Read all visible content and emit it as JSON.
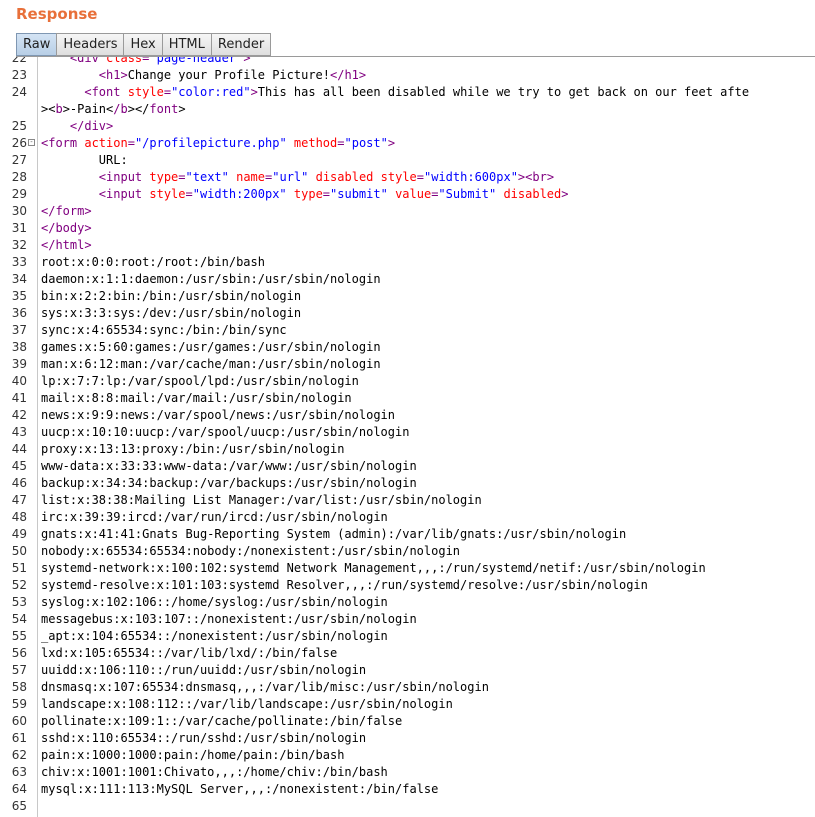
{
  "panel": {
    "title": "Response"
  },
  "tabs": [
    {
      "label": "Raw",
      "active": true
    },
    {
      "label": "Headers",
      "active": false
    },
    {
      "label": "Hex",
      "active": false
    },
    {
      "label": "HTML",
      "active": false
    },
    {
      "label": "Render",
      "active": false
    }
  ],
  "colors": {
    "title": "#e8703a",
    "tag": "#800080",
    "attribute": "#ff0000",
    "value": "#0000ff",
    "text": "#000000"
  },
  "lines": [
    {
      "num": "22",
      "fold": "",
      "tokens": [
        [
          "text",
          "    "
        ],
        [
          "tag",
          "<div "
        ],
        [
          "attr",
          "class"
        ],
        [
          "tag",
          "="
        ],
        [
          "val",
          "\"page-header\""
        ],
        [
          "tag",
          ">"
        ]
      ]
    },
    {
      "num": "23",
      "fold": "",
      "tokens": [
        [
          "text",
          "        "
        ],
        [
          "tag",
          "<h1>"
        ],
        [
          "text",
          "Change your Profile Picture!"
        ],
        [
          "tag",
          "</h1>"
        ]
      ]
    },
    {
      "num": "24",
      "fold": "",
      "tokens": [
        [
          "text",
          "      "
        ],
        [
          "tag",
          "<font "
        ],
        [
          "attr",
          "style"
        ],
        [
          "tag",
          "="
        ],
        [
          "val",
          "\"color:red\""
        ],
        [
          "tag",
          ">"
        ],
        [
          "text",
          "This has all been disabled while we try to get back on our feet afte"
        ]
      ]
    },
    {
      "num": "",
      "fold": "",
      "tokens": [
        [
          "text",
          "><"
        ],
        [
          "tag",
          "b"
        ],
        [
          "text",
          ">-Pain<"
        ],
        [
          "tag",
          "/b"
        ],
        [
          "text",
          "></"
        ],
        [
          "tag",
          "font"
        ],
        [
          "text",
          ">"
        ]
      ]
    },
    {
      "num": "25",
      "fold": "",
      "tokens": [
        [
          "text",
          "    "
        ],
        [
          "tag",
          "</div>"
        ]
      ]
    },
    {
      "num": "26",
      "fold": "-",
      "tokens": [
        [
          "tag",
          "<form "
        ],
        [
          "attr",
          "action"
        ],
        [
          "tag",
          "="
        ],
        [
          "val",
          "\"/profilepicture.php\""
        ],
        [
          "tag",
          " "
        ],
        [
          "attr",
          "method"
        ],
        [
          "tag",
          "="
        ],
        [
          "val",
          "\"post\""
        ],
        [
          "tag",
          ">"
        ]
      ]
    },
    {
      "num": "27",
      "fold": "",
      "tokens": [
        [
          "text",
          "        URL:"
        ]
      ]
    },
    {
      "num": "28",
      "fold": "",
      "tokens": [
        [
          "text",
          "        "
        ],
        [
          "tag",
          "<input "
        ],
        [
          "attr",
          "type"
        ],
        [
          "tag",
          "="
        ],
        [
          "val",
          "\"text\""
        ],
        [
          "tag",
          " "
        ],
        [
          "attr",
          "name"
        ],
        [
          "tag",
          "="
        ],
        [
          "val",
          "\"url\""
        ],
        [
          "tag",
          " "
        ],
        [
          "attr",
          "disabled"
        ],
        [
          "tag",
          " "
        ],
        [
          "attr",
          "style"
        ],
        [
          "tag",
          "="
        ],
        [
          "val",
          "\"width:600px\""
        ],
        [
          "tag",
          "><br>"
        ]
      ]
    },
    {
      "num": "29",
      "fold": "",
      "tokens": [
        [
          "text",
          "        "
        ],
        [
          "tag",
          "<input "
        ],
        [
          "attr",
          "style"
        ],
        [
          "tag",
          "="
        ],
        [
          "val",
          "\"width:200px\""
        ],
        [
          "tag",
          " "
        ],
        [
          "attr",
          "type"
        ],
        [
          "tag",
          "="
        ],
        [
          "val",
          "\"submit\""
        ],
        [
          "tag",
          " "
        ],
        [
          "attr",
          "value"
        ],
        [
          "tag",
          "="
        ],
        [
          "val",
          "\"Submit\""
        ],
        [
          "tag",
          " "
        ],
        [
          "attr",
          "disabled"
        ],
        [
          "tag",
          ">"
        ]
      ]
    },
    {
      "num": "30",
      "fold": "",
      "tokens": [
        [
          "tag",
          "</form>"
        ]
      ]
    },
    {
      "num": "31",
      "fold": "",
      "tokens": [
        [
          "tag",
          "</body>"
        ]
      ]
    },
    {
      "num": "32",
      "fold": "",
      "tokens": [
        [
          "tag",
          "</html>"
        ]
      ]
    },
    {
      "num": "33",
      "fold": "",
      "tokens": [
        [
          "text",
          "root:x:0:0:root:/root:/bin/bash"
        ]
      ]
    },
    {
      "num": "34",
      "fold": "",
      "tokens": [
        [
          "text",
          "daemon:x:1:1:daemon:/usr/sbin:/usr/sbin/nologin"
        ]
      ]
    },
    {
      "num": "35",
      "fold": "",
      "tokens": [
        [
          "text",
          "bin:x:2:2:bin:/bin:/usr/sbin/nologin"
        ]
      ]
    },
    {
      "num": "36",
      "fold": "",
      "tokens": [
        [
          "text",
          "sys:x:3:3:sys:/dev:/usr/sbin/nologin"
        ]
      ]
    },
    {
      "num": "37",
      "fold": "",
      "tokens": [
        [
          "text",
          "sync:x:4:65534:sync:/bin:/bin/sync"
        ]
      ]
    },
    {
      "num": "38",
      "fold": "",
      "tokens": [
        [
          "text",
          "games:x:5:60:games:/usr/games:/usr/sbin/nologin"
        ]
      ]
    },
    {
      "num": "39",
      "fold": "",
      "tokens": [
        [
          "text",
          "man:x:6:12:man:/var/cache/man:/usr/sbin/nologin"
        ]
      ]
    },
    {
      "num": "40",
      "fold": "",
      "tokens": [
        [
          "text",
          "lp:x:7:7:lp:/var/spool/lpd:/usr/sbin/nologin"
        ]
      ]
    },
    {
      "num": "41",
      "fold": "",
      "tokens": [
        [
          "text",
          "mail:x:8:8:mail:/var/mail:/usr/sbin/nologin"
        ]
      ]
    },
    {
      "num": "42",
      "fold": "",
      "tokens": [
        [
          "text",
          "news:x:9:9:news:/var/spool/news:/usr/sbin/nologin"
        ]
      ]
    },
    {
      "num": "43",
      "fold": "",
      "tokens": [
        [
          "text",
          "uucp:x:10:10:uucp:/var/spool/uucp:/usr/sbin/nologin"
        ]
      ]
    },
    {
      "num": "44",
      "fold": "",
      "tokens": [
        [
          "text",
          "proxy:x:13:13:proxy:/bin:/usr/sbin/nologin"
        ]
      ]
    },
    {
      "num": "45",
      "fold": "",
      "tokens": [
        [
          "text",
          "www-data:x:33:33:www-data:/var/www:/usr/sbin/nologin"
        ]
      ]
    },
    {
      "num": "46",
      "fold": "",
      "tokens": [
        [
          "text",
          "backup:x:34:34:backup:/var/backups:/usr/sbin/nologin"
        ]
      ]
    },
    {
      "num": "47",
      "fold": "",
      "tokens": [
        [
          "text",
          "list:x:38:38:Mailing List Manager:/var/list:/usr/sbin/nologin"
        ]
      ]
    },
    {
      "num": "48",
      "fold": "",
      "tokens": [
        [
          "text",
          "irc:x:39:39:ircd:/var/run/ircd:/usr/sbin/nologin"
        ]
      ]
    },
    {
      "num": "49",
      "fold": "",
      "tokens": [
        [
          "text",
          "gnats:x:41:41:Gnats Bug-Reporting System (admin):/var/lib/gnats:/usr/sbin/nologin"
        ]
      ]
    },
    {
      "num": "50",
      "fold": "",
      "tokens": [
        [
          "text",
          "nobody:x:65534:65534:nobody:/nonexistent:/usr/sbin/nologin"
        ]
      ]
    },
    {
      "num": "51",
      "fold": "",
      "tokens": [
        [
          "text",
          "systemd-network:x:100:102:systemd Network Management,,,:/run/systemd/netif:/usr/sbin/nologin"
        ]
      ]
    },
    {
      "num": "52",
      "fold": "",
      "tokens": [
        [
          "text",
          "systemd-resolve:x:101:103:systemd Resolver,,,:/run/systemd/resolve:/usr/sbin/nologin"
        ]
      ]
    },
    {
      "num": "53",
      "fold": "",
      "tokens": [
        [
          "text",
          "syslog:x:102:106::/home/syslog:/usr/sbin/nologin"
        ]
      ]
    },
    {
      "num": "54",
      "fold": "",
      "tokens": [
        [
          "text",
          "messagebus:x:103:107::/nonexistent:/usr/sbin/nologin"
        ]
      ]
    },
    {
      "num": "55",
      "fold": "",
      "tokens": [
        [
          "text",
          "_apt:x:104:65534::/nonexistent:/usr/sbin/nologin"
        ]
      ]
    },
    {
      "num": "56",
      "fold": "",
      "tokens": [
        [
          "text",
          "lxd:x:105:65534::/var/lib/lxd/:/bin/false"
        ]
      ]
    },
    {
      "num": "57",
      "fold": "",
      "tokens": [
        [
          "text",
          "uuidd:x:106:110::/run/uuidd:/usr/sbin/nologin"
        ]
      ]
    },
    {
      "num": "58",
      "fold": "",
      "tokens": [
        [
          "text",
          "dnsmasq:x:107:65534:dnsmasq,,,:/var/lib/misc:/usr/sbin/nologin"
        ]
      ]
    },
    {
      "num": "59",
      "fold": "",
      "tokens": [
        [
          "text",
          "landscape:x:108:112::/var/lib/landscape:/usr/sbin/nologin"
        ]
      ]
    },
    {
      "num": "60",
      "fold": "",
      "tokens": [
        [
          "text",
          "pollinate:x:109:1::/var/cache/pollinate:/bin/false"
        ]
      ]
    },
    {
      "num": "61",
      "fold": "",
      "tokens": [
        [
          "text",
          "sshd:x:110:65534::/run/sshd:/usr/sbin/nologin"
        ]
      ]
    },
    {
      "num": "62",
      "fold": "",
      "tokens": [
        [
          "text",
          "pain:x:1000:1000:pain:/home/pain:/bin/bash"
        ]
      ]
    },
    {
      "num": "63",
      "fold": "",
      "tokens": [
        [
          "text",
          "chiv:x:1001:1001:Chivato,,,:/home/chiv:/bin/bash"
        ]
      ]
    },
    {
      "num": "64",
      "fold": "",
      "tokens": [
        [
          "text",
          "mysql:x:111:113:MySQL Server,,,:/nonexistent:/bin/false"
        ]
      ]
    },
    {
      "num": "65",
      "fold": "",
      "tokens": [
        [
          "text",
          ""
        ]
      ]
    }
  ]
}
